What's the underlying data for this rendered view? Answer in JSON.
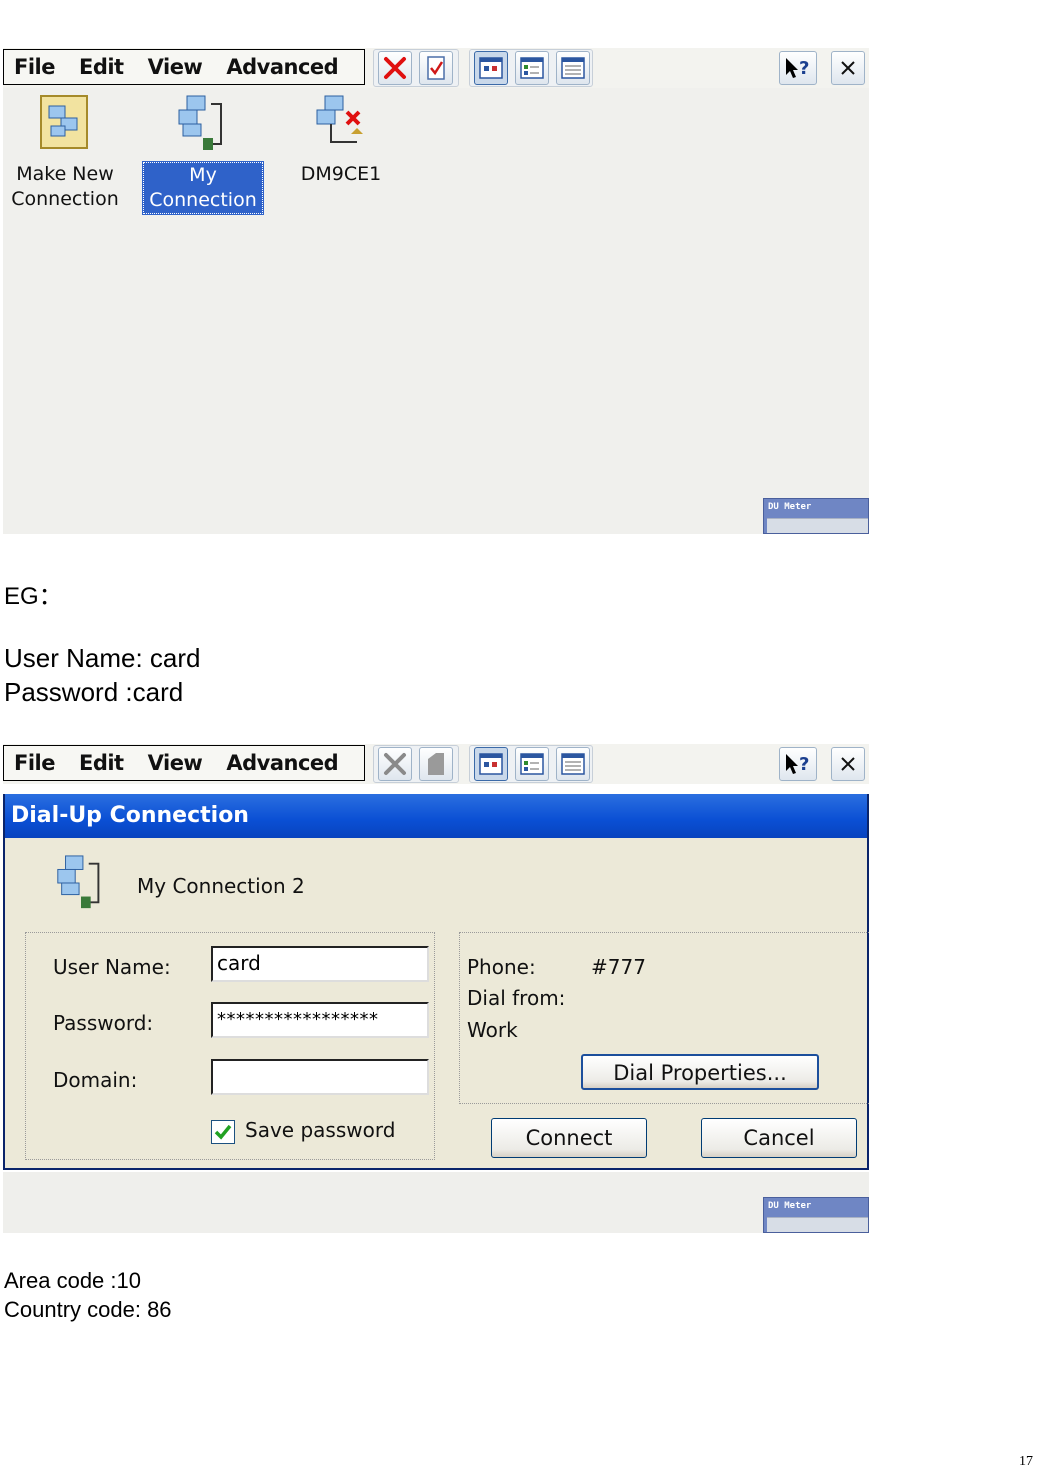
{
  "menu": {
    "file": "File",
    "edit": "Edit",
    "view": "View",
    "advanced": "Advanced"
  },
  "desktop": {
    "icons": [
      {
        "label": "Make New\nConnection"
      },
      {
        "label": "My\nConnection"
      },
      {
        "label": "DM9CE1"
      }
    ]
  },
  "du_meter_label": "DU Meter",
  "doc": {
    "eg": "EG：",
    "user_name_line": "User Name: card",
    "password_line": "Password :card",
    "area_code": "Area code :10",
    "country_code": "Country code: 86",
    "page_number": "17"
  },
  "dialog": {
    "title": "Dial-Up Connection",
    "connection_name": "My Connection 2",
    "user_name_label": "User Name:",
    "user_name_value": "card",
    "password_label": "Password:",
    "password_value": "*****************",
    "domain_label": "Domain:",
    "domain_value": "",
    "save_password_label": "Save password",
    "save_password_checked": true,
    "phone_label": "Phone:",
    "phone_value": "#777",
    "dial_from_label": "Dial from:",
    "dial_from_value": "Work",
    "dial_properties_button": "Dial Properties...",
    "connect_button": "Connect",
    "cancel_button": "Cancel"
  }
}
